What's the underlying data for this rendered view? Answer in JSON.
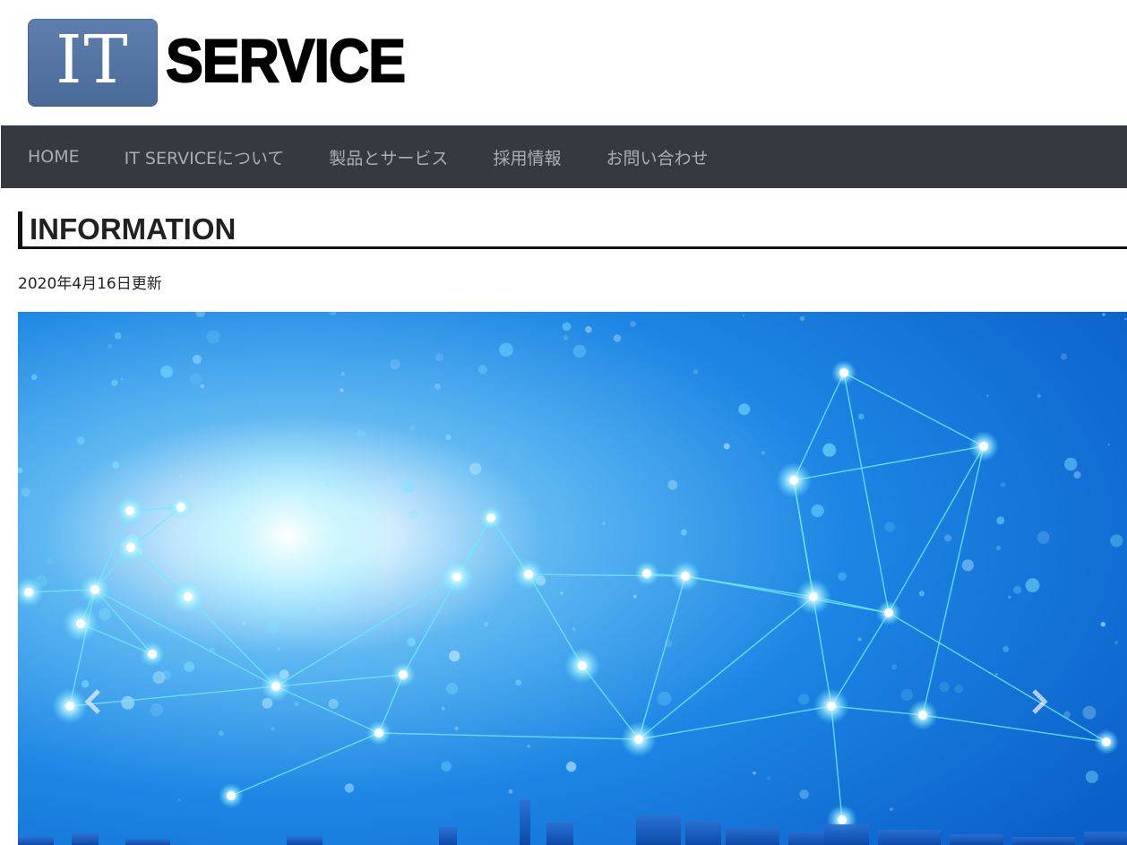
{
  "header": {
    "logo": {
      "mark": "IT",
      "word": "SERVICE"
    }
  },
  "nav": {
    "items": [
      {
        "label": "HOME"
      },
      {
        "label": "IT SERVICEについて"
      },
      {
        "label": "製品とサービス"
      },
      {
        "label": "採用情報"
      },
      {
        "label": "お問い合わせ"
      }
    ]
  },
  "main": {
    "section_title": "INFORMATION",
    "updated": "2020年4月16日更新"
  },
  "carousel": {
    "prev_icon": "chevron-left-icon",
    "next_icon": "chevron-right-icon"
  },
  "colors": {
    "navbar_bg": "#343a40",
    "nav_text": "#a9aeb3",
    "logo_box": "#4f6f9f",
    "hero_blue": "#0c6fd8"
  }
}
